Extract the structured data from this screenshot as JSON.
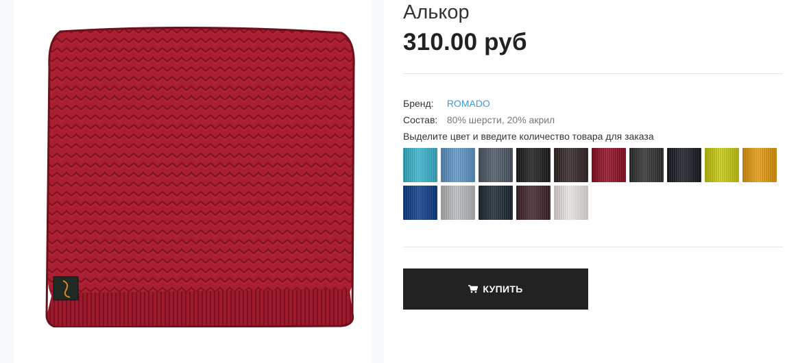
{
  "product": {
    "title": "Алькор",
    "price": "310.00 руб",
    "brand_label": "Бренд:",
    "brand_value": "ROMADO",
    "composition_label": "Состав:",
    "composition_value": "80% шерсти, 20% акрил",
    "instruction": "Выделите цвет и введите количество товара для заказа",
    "buy_label": "КУПИТЬ",
    "buy_icon": "shopping-cart-icon",
    "image_color": "#a81f31"
  },
  "swatches": [
    {
      "name": "turquoise",
      "color": "#37b5cf"
    },
    {
      "name": "sky-blue",
      "color": "#5b95c6"
    },
    {
      "name": "slate-grey",
      "color": "#4c5664"
    },
    {
      "name": "black",
      "color": "#1b1a1a"
    },
    {
      "name": "dark-brown",
      "color": "#2f2322"
    },
    {
      "name": "crimson",
      "color": "#8e0b21"
    },
    {
      "name": "charcoal",
      "color": "#2e2e2e"
    },
    {
      "name": "navy-black",
      "color": "#14191f"
    },
    {
      "name": "lime-yellow",
      "color": "#c8cc0a"
    },
    {
      "name": "orange",
      "color": "#e7990a"
    },
    {
      "name": "royal-blue",
      "color": "#0b3a8c"
    },
    {
      "name": "light-grey",
      "color": "#b9bbbd"
    },
    {
      "name": "dark-navy",
      "color": "#1a2631"
    },
    {
      "name": "plum-brown",
      "color": "#3f2227"
    },
    {
      "name": "off-white",
      "color": "#ebe7e4"
    }
  ]
}
